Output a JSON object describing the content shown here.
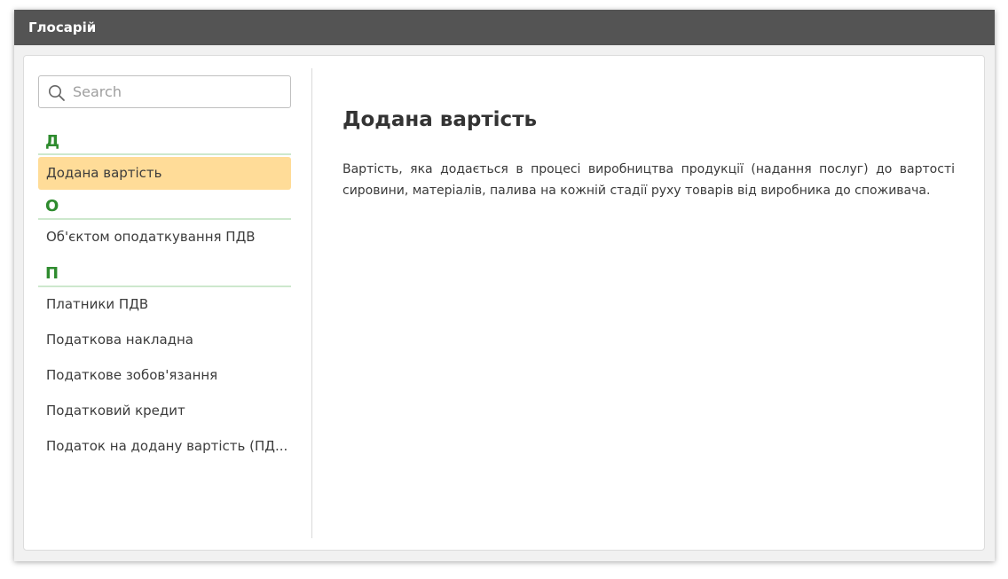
{
  "window": {
    "title": "Глосарій"
  },
  "search": {
    "placeholder": "Search",
    "value": ""
  },
  "glossary": {
    "groups": [
      {
        "letter": "Д",
        "items": [
          "Додана вартість"
        ]
      },
      {
        "letter": "О",
        "items": [
          "Об'єктом оподаткування ПДВ"
        ]
      },
      {
        "letter": "П",
        "items": [
          "Платники ПДВ",
          "Податкова накладна",
          "Податкове зобов'язання",
          "Податковий кредит",
          "Податок на додану вартість (ПД..."
        ]
      }
    ],
    "selected": "Додана вартість"
  },
  "article": {
    "title": "Додана вартість",
    "body": "Вартість, яка додається в процесі виробництва продукції (надання послуг) до вартості сировини, матеріалів, палива на кожній стадії руху товарів від виробника до споживача."
  },
  "colors": {
    "titlebar": "#545454",
    "letter": "#2e8b2e",
    "selected_bg": "#ffdc98"
  }
}
